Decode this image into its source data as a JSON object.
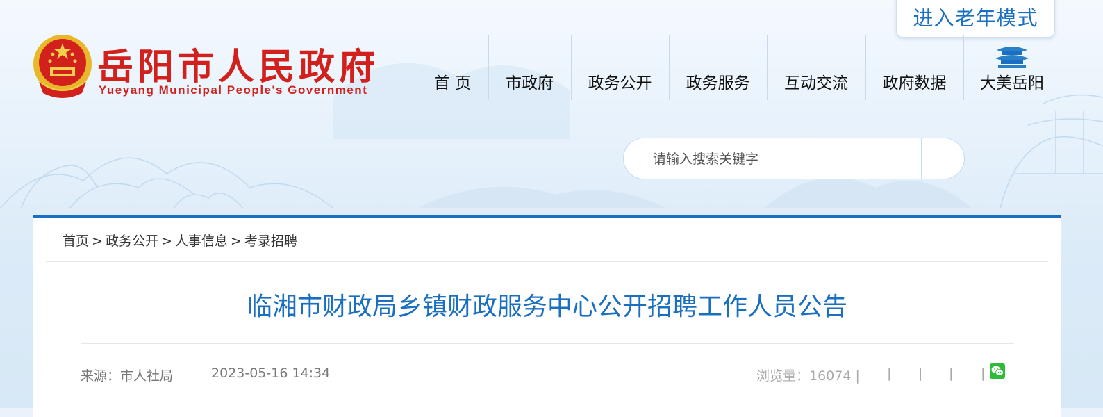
{
  "header": {
    "logo_cn": "岳阳市人民政府",
    "logo_en": "Yueyang Municipal People's Government",
    "elder_mode": "进入老年模式",
    "brand_color": "#d2201c",
    "accent_color": "#1a6fc1"
  },
  "nav": {
    "items": [
      {
        "label": "首 页"
      },
      {
        "label": "市政府"
      },
      {
        "label": "政务公开"
      },
      {
        "label": "政务服务"
      },
      {
        "label": "互动交流"
      },
      {
        "label": "政府数据"
      },
      {
        "label": "大美岳阳",
        "icon": "pavilion-icon"
      }
    ]
  },
  "search": {
    "placeholder": "请输入搜索关键字"
  },
  "breadcrumb": {
    "items": [
      "首页",
      "政务公开",
      "人事信息",
      "考录招聘"
    ],
    "separator": ">"
  },
  "article": {
    "title": "临湘市财政局乡镇财政服务中心公开招聘工作人员公告",
    "source": "来源：市人社局",
    "date": "2023-05-16 14:34",
    "views_label": "浏览量：16074 |",
    "share_separator": "|",
    "share_icon": "wechat-icon"
  }
}
